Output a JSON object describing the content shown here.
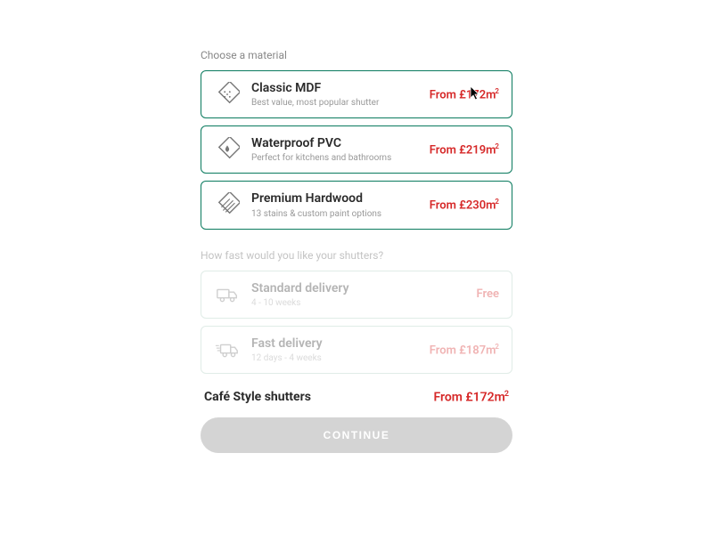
{
  "material_section": {
    "label": "Choose a material",
    "options": [
      {
        "icon": "mdf",
        "title": "Classic MDF",
        "subtitle": "Best value, most popular shutter",
        "price_prefix": "From £",
        "price_value": "172",
        "price_suffix": "m",
        "price_super": "2"
      },
      {
        "icon": "pvc",
        "title": "Waterproof PVC",
        "subtitle": "Perfect for kitchens and bathrooms",
        "price_prefix": "From £",
        "price_value": "219",
        "price_suffix": "m",
        "price_super": "2"
      },
      {
        "icon": "hardwood",
        "title": "Premium Hardwood",
        "subtitle": "13 stains & custom paint options",
        "price_prefix": "From £",
        "price_value": "230",
        "price_suffix": "m",
        "price_super": "2"
      }
    ]
  },
  "delivery_section": {
    "label": "How fast would you like your shutters?",
    "options": [
      {
        "icon": "truck",
        "title": "Standard delivery",
        "subtitle": "4 - 10 weeks",
        "price_text": "Free"
      },
      {
        "icon": "fast-truck",
        "title": "Fast delivery",
        "subtitle": "12 days - 4 weeks",
        "price_prefix": "From £",
        "price_value": "187",
        "price_suffix": "m",
        "price_super": "2"
      }
    ]
  },
  "summary": {
    "title": "Café Style shutters",
    "price_prefix": "From £",
    "price_value": "172",
    "price_suffix": "m",
    "price_super": "2"
  },
  "continue_label": "CONTINUE"
}
